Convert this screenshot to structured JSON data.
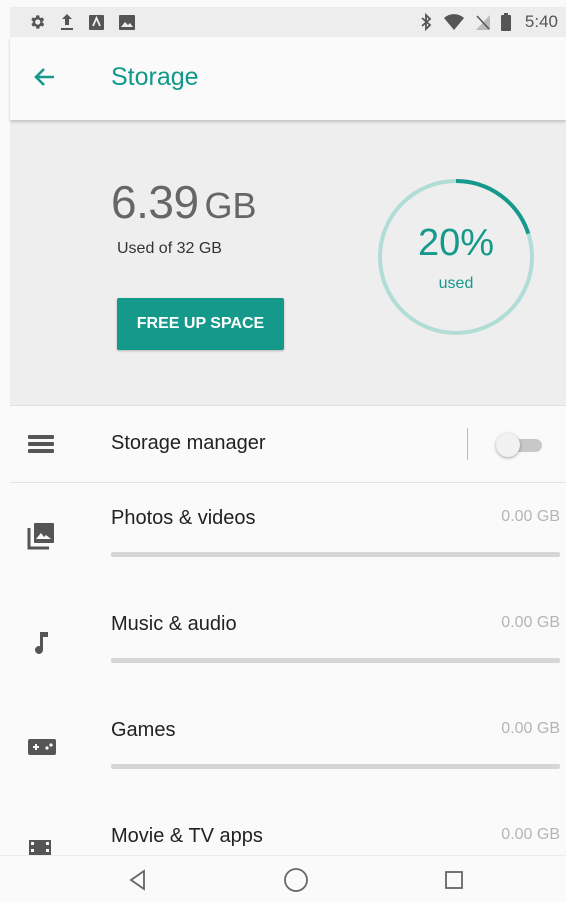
{
  "status_bar": {
    "left_icons": [
      "settings-icon",
      "upload-icon",
      "app-notification-icon",
      "image-notification-icon"
    ],
    "right_icons": [
      "bluetooth-icon",
      "wifi-icon",
      "no-sim-icon",
      "battery-icon"
    ],
    "time": "5:40"
  },
  "app_bar": {
    "title": "Storage",
    "back_icon": "arrow-left-icon"
  },
  "summary": {
    "used_value": "6.39",
    "used_unit": "GB",
    "used_of": "Used of 32 GB",
    "free_button_label": "FREE UP SPACE",
    "percent_used": 20,
    "percent_text": "20%",
    "percent_caption": "used"
  },
  "storage_manager": {
    "label": "Storage manager",
    "icon": "list-icon",
    "toggle_on": false
  },
  "categories": [
    {
      "label": "Photos & videos",
      "size": "0.00 GB",
      "icon": "photo-library-icon",
      "fill": 0
    },
    {
      "label": "Music & audio",
      "size": "0.00 GB",
      "icon": "music-note-icon",
      "fill": 0
    },
    {
      "label": "Games",
      "size": "0.00 GB",
      "icon": "gamepad-icon",
      "fill": 0
    },
    {
      "label": "Movie & TV apps",
      "size": "0.00 GB",
      "icon": "movie-icon",
      "fill": 0
    }
  ],
  "nav": {
    "back": "nav-back-icon",
    "home": "nav-home-icon",
    "recents": "nav-recents-icon"
  },
  "colors": {
    "accent": "#15998b",
    "ring_track": "#b2dcd6",
    "summary_bg": "#eeeeee"
  }
}
